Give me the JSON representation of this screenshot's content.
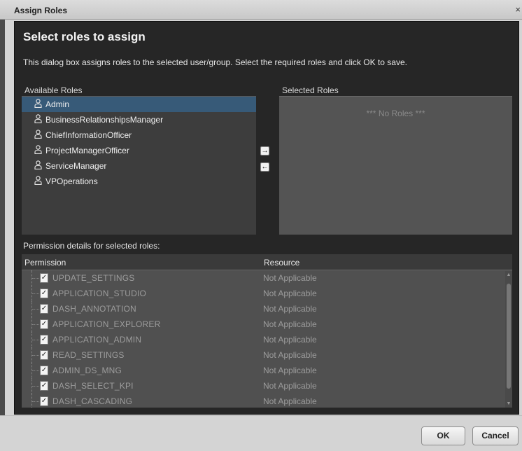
{
  "window": {
    "title": "Assign Roles",
    "close_glyph": "×"
  },
  "dialog": {
    "heading": "Select roles to assign",
    "description": "This dialog box assigns roles to the selected user/group. Select the required roles and click OK to save."
  },
  "available": {
    "label": "Available Roles",
    "roles": [
      {
        "name": "Admin",
        "selected": true
      },
      {
        "name": "BusinessRelationshipsManager"
      },
      {
        "name": "ChiefInformationOfficer"
      },
      {
        "name": "ProjectManagerOfficer"
      },
      {
        "name": "ServiceManager"
      },
      {
        "name": "VPOperations"
      }
    ]
  },
  "move_buttons": {
    "add_glyph": "→",
    "remove_glyph": "←"
  },
  "selected": {
    "label": "Selected Roles",
    "empty_text": "*** No Roles ***"
  },
  "permissions": {
    "label": "Permission details for selected roles:",
    "columns": [
      "Permission",
      "Resource"
    ],
    "rows": [
      {
        "permission": "UPDATE_SETTINGS",
        "resource": "Not Applicable"
      },
      {
        "permission": "APPLICATION_STUDIO",
        "resource": "Not Applicable"
      },
      {
        "permission": "DASH_ANNOTATION",
        "resource": "Not Applicable"
      },
      {
        "permission": "APPLICATION_EXPLORER",
        "resource": "Not Applicable"
      },
      {
        "permission": "APPLICATION_ADMIN",
        "resource": "Not Applicable"
      },
      {
        "permission": "READ_SETTINGS",
        "resource": "Not Applicable"
      },
      {
        "permission": "ADMIN_DS_MNG",
        "resource": "Not Applicable"
      },
      {
        "permission": "DASH_SELECT_KPI",
        "resource": "Not Applicable"
      },
      {
        "permission": "DASH_CASCADING",
        "resource": "Not Applicable"
      }
    ]
  },
  "buttons": {
    "ok": "OK",
    "cancel": "Cancel"
  },
  "colors": {
    "panel": "#262626",
    "selected_row": "#375a78",
    "disabled_text": "#9c9c9c"
  }
}
